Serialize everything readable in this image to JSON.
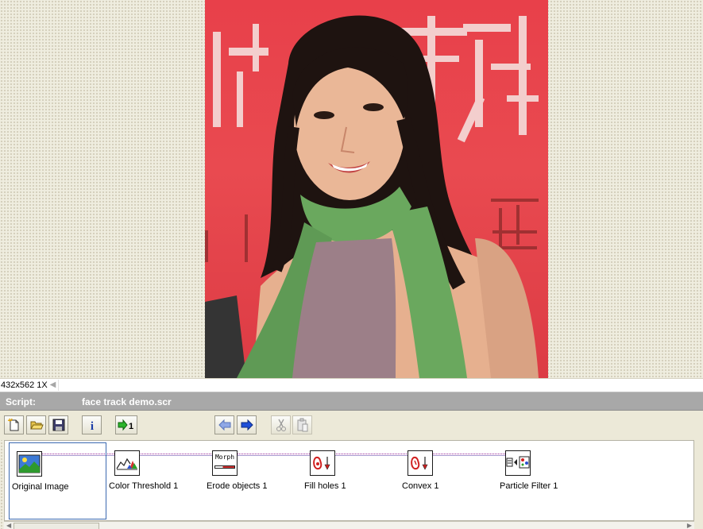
{
  "viewer": {
    "image_info": "432x562 1X",
    "photo_icon": "portrait-photo"
  },
  "script": {
    "label": "Script:",
    "name": "face track demo.scr"
  },
  "toolbar": {
    "buttons": [
      {
        "icon": "new-script-icon"
      },
      {
        "icon": "open-folder-icon"
      },
      {
        "icon": "save-disk-icon"
      },
      {
        "icon": "info-icon"
      },
      {
        "icon": "run-once-icon"
      },
      {
        "icon": "arrow-left-icon"
      },
      {
        "icon": "arrow-right-icon"
      },
      {
        "icon": "cut-icon"
      },
      {
        "icon": "paste-icon"
      }
    ]
  },
  "pipeline": {
    "steps": [
      {
        "label": "Original Image",
        "icon": "original-image-icon"
      },
      {
        "label": "Color Threshold 1",
        "icon": "color-threshold-icon"
      },
      {
        "label": "Erode objects 1",
        "icon": "morph-icon",
        "icon_text": "Morph"
      },
      {
        "label": "Fill holes 1",
        "icon": "fill-holes-icon"
      },
      {
        "label": "Convex 1",
        "icon": "convex-icon"
      },
      {
        "label": "Particle Filter 1",
        "icon": "particle-filter-icon"
      }
    ]
  },
  "colors": {
    "photo_background": "#e8404a",
    "header_bar": "#a8a8a8",
    "toolbar": "#ece9d8",
    "wire": "#9a2a9a",
    "selection": "#3b69b0"
  }
}
